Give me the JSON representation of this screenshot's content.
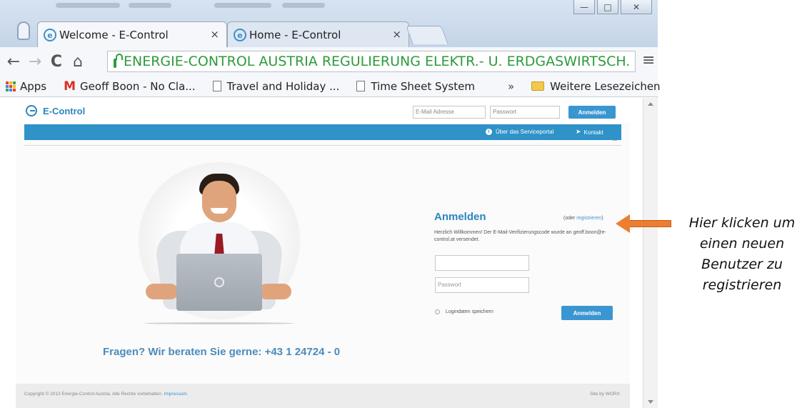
{
  "browser": {
    "tabs": [
      {
        "title": "Welcome - E-Control",
        "close": "×",
        "active": true
      },
      {
        "title": "Home - E-Control",
        "close": "×",
        "active": false
      }
    ],
    "window_controls": {
      "minimize": "—",
      "maximize": "□",
      "close": "✕"
    },
    "nav": {
      "back": "←",
      "forward": "→",
      "reload": "C",
      "home": "⌂"
    },
    "url_text": "ENERGIE-CONTROL AUSTRIA REGULIERUNG ELEKTR.- U. ERDGASWIRTSCH. [A",
    "menu_glyph": "≡",
    "bookmarks": {
      "apps": "Apps",
      "items": [
        "Geoff Boon - No Cla...",
        "Travel and Holiday ...",
        "Time Sheet System"
      ],
      "overflow": "»",
      "other": "Weitere Lesezeichen"
    }
  },
  "site": {
    "logo_text": "E-Control",
    "header": {
      "email_placeholder": "E-Mail Adresse",
      "password_placeholder": "Passwort",
      "login_button": "Anmelden"
    },
    "bar_links": {
      "about": "Über das Serviceportal",
      "contact": "Kontakt"
    },
    "contact_line": "Fragen? Wir beraten Sie gerne: +43 1 24724 - 0",
    "login": {
      "title": "Anmelden",
      "register_prefix": "(oder ",
      "register_link": "registrieren",
      "register_suffix": ")",
      "welcome": "Herzlich Willkommen! Der E-Mail-Verifizierungscode wurde an geoff.boon@e-control.at versendet.",
      "email_value": "",
      "password_placeholder": "Passwort",
      "remember": "Logindaten speichern",
      "button": "Anmelden"
    },
    "footer": {
      "copyright": "Copyright © 2013 Energie-Control Austria. Alle Rechte vorbehalten.",
      "impressum": "Impressum.",
      "site_by": "Site by WORX"
    }
  },
  "annotation": {
    "lines": [
      "Hier klicken um",
      "einen neuen",
      "Benutzer zu",
      "registrieren"
    ],
    "arrow_color": "#ed7d31"
  },
  "colors": {
    "brand_blue": "#2f92c8",
    "link_blue": "#3a96d1",
    "secure_green": "#2e9a3c"
  }
}
